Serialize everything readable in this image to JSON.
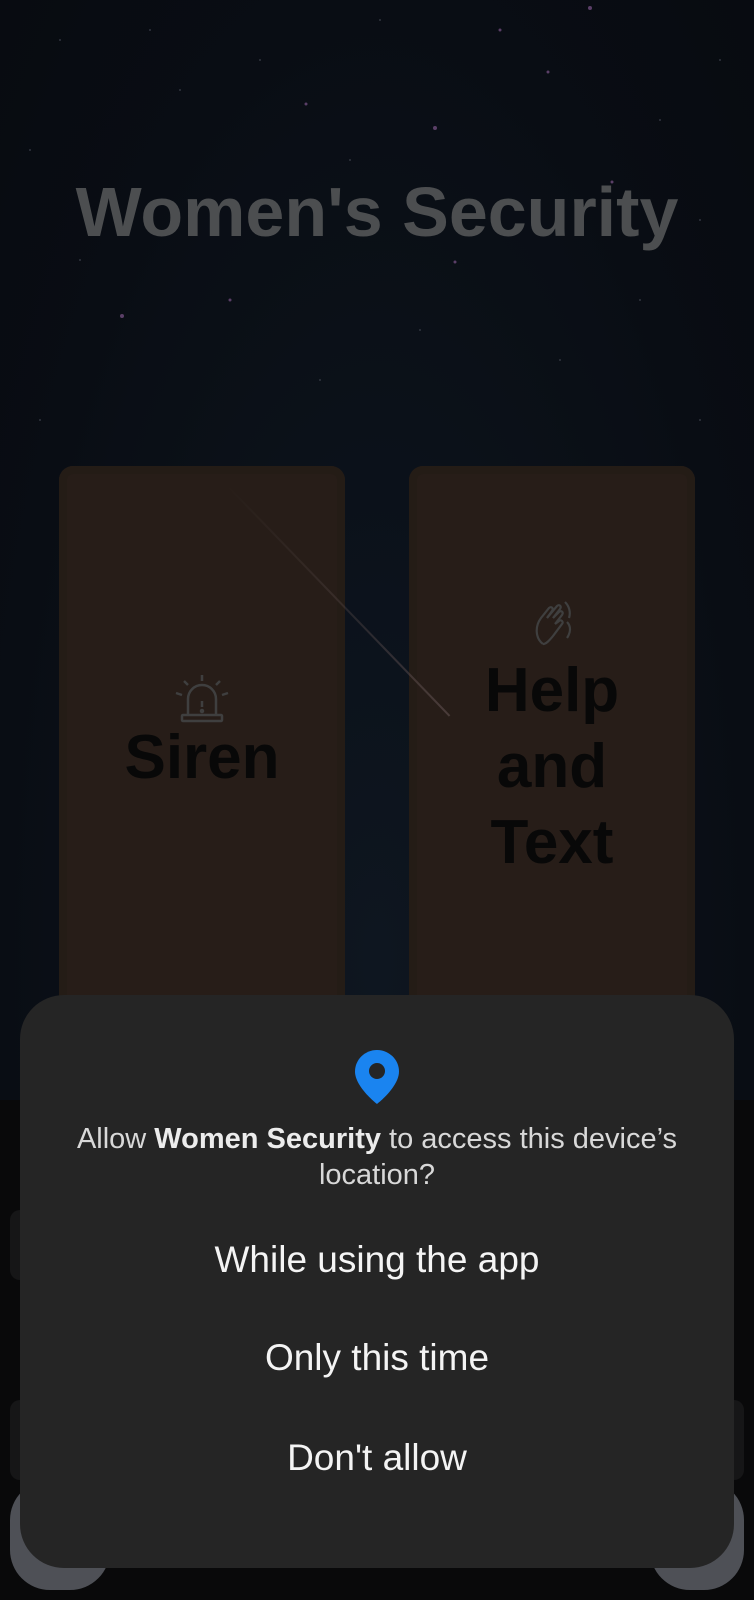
{
  "app": {
    "title": "Women's Security",
    "cards": [
      {
        "label": "Siren",
        "icon": "siren-icon"
      },
      {
        "label": "Help and Text",
        "icon": "help-hands-icon"
      }
    ]
  },
  "dialog": {
    "icon": "location-pin-icon",
    "accent_color": "#1a84f0",
    "prompt_prefix": "Allow ",
    "app_name": "Women Security",
    "prompt_suffix": " to access this device’s location?",
    "options": [
      "While using the app",
      "Only this time",
      "Don't allow"
    ]
  }
}
